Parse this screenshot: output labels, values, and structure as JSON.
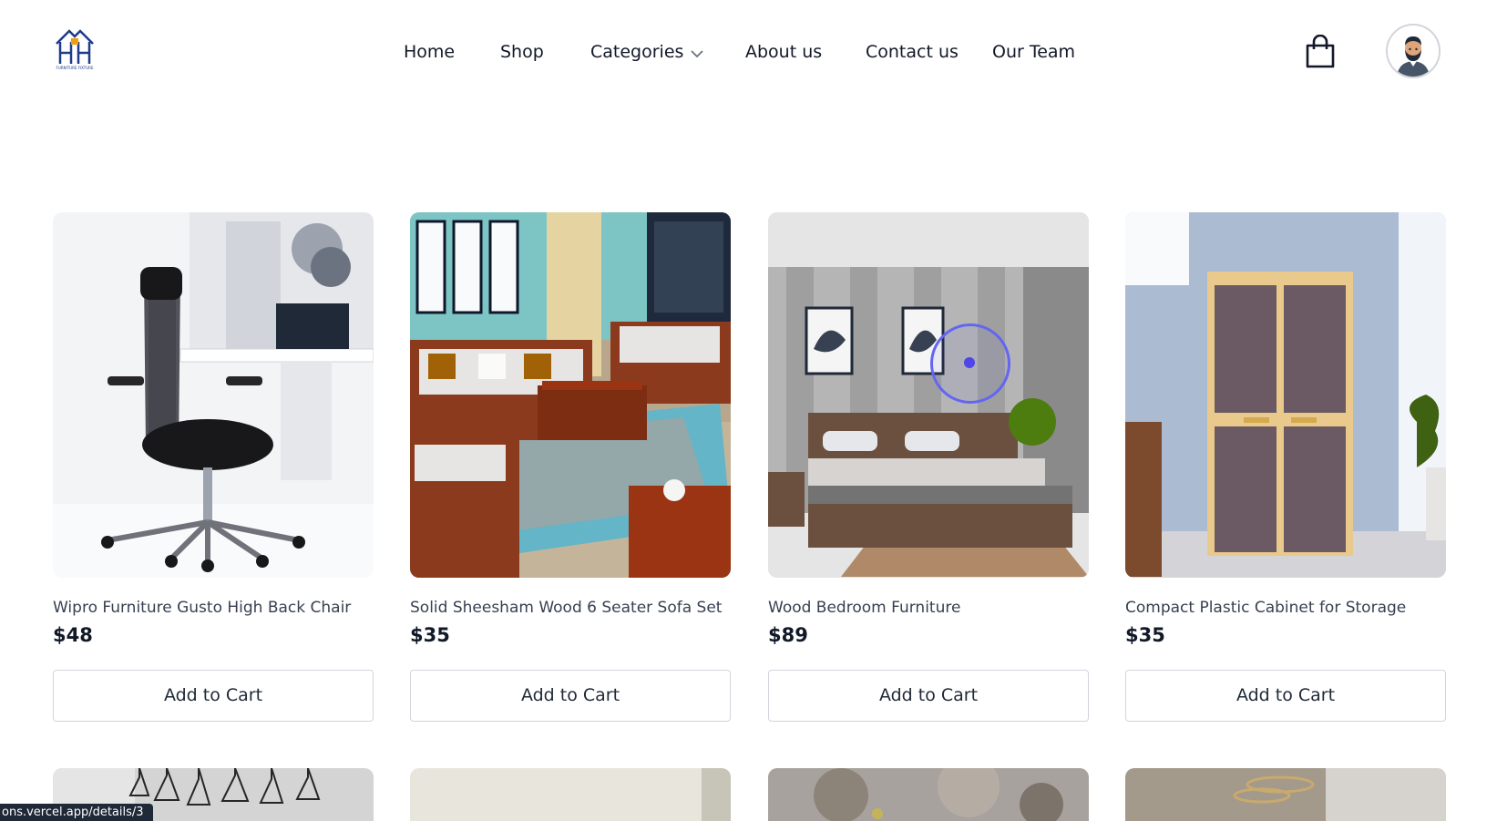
{
  "header": {
    "logo_text": "FURNITURE FIXTURE",
    "nav": [
      {
        "label": "Home"
      },
      {
        "label": "Shop"
      },
      {
        "label": "Categories"
      },
      {
        "label": "About us"
      },
      {
        "label": "Contact us"
      },
      {
        "label": "Our Team"
      }
    ],
    "icons": {
      "cart": "shopping-bag-icon",
      "user": "avatar",
      "dropdown": "chevron-down-icon"
    }
  },
  "products": [
    {
      "name": "Wipro Furniture Gusto High Back Chair",
      "price": "$48",
      "button": "Add to Cart"
    },
    {
      "name": "Solid Sheesham Wood 6 Seater Sofa Set",
      "price": "$35",
      "button": "Add to Cart"
    },
    {
      "name": "Wood Bedroom Furniture",
      "price": "$89",
      "button": "Add to Cart"
    },
    {
      "name": "Compact Plastic Cabinet for Storage",
      "price": "$35",
      "button": "Add to Cart"
    }
  ],
  "status_url": "ons.vercel.app/details/3",
  "colors": {
    "accent": "#4f46e5",
    "text": "#111827",
    "border": "#d1d5db"
  }
}
